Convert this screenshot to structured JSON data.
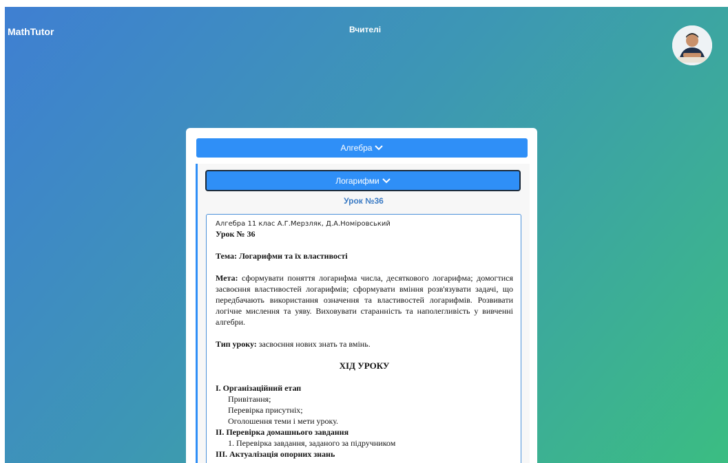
{
  "header": {
    "brand": "MathTutor",
    "nav_link": "Вчителі",
    "avatar_alt": "user-avatar"
  },
  "topic": {
    "label": "Алгебра",
    "chevron": "chevron-down-icon"
  },
  "subtopic": {
    "label": "Логарифми",
    "chevron": "chevron-down-icon"
  },
  "lesson": {
    "title": "Урок №36"
  },
  "document": {
    "source": "Алгебра 11 клас А.Г.Мерзляк, Д.А.Номіровський",
    "heading": "Урок № 36",
    "topic_label": "Тема: Логарифми та їх властивості",
    "goal_label": "Мета:",
    "goal_text": " сформувати поняття логарифма числа, десяткового логарифма; домогтися засвоєння властивостей логарифмів; сформувати вміння розв'язувати задачі, що передбачають використання означення та властивостей логарифмів. Розвивати логічне мислення та уяву. Виховувати старанність та наполегливість у вивченні алгебри.",
    "type_label": "Тип уроку:",
    "type_text": " засвоєння нових знать та вмінь.",
    "progress_heading": "ХІД УРОКУ",
    "stage1_title": "І. Організаційний етап",
    "stage1_items": [
      "Привітання;",
      "Перевірка присутніх;",
      "Оголошення теми і мети уроку."
    ],
    "stage2_title": "ІІ. Перевірка домашнього завдання",
    "stage2_item1": "1.  Перевірка завдання, заданого за підручником",
    "stage3_partial": "ІІІ. Актуалізація опорних знань"
  }
}
